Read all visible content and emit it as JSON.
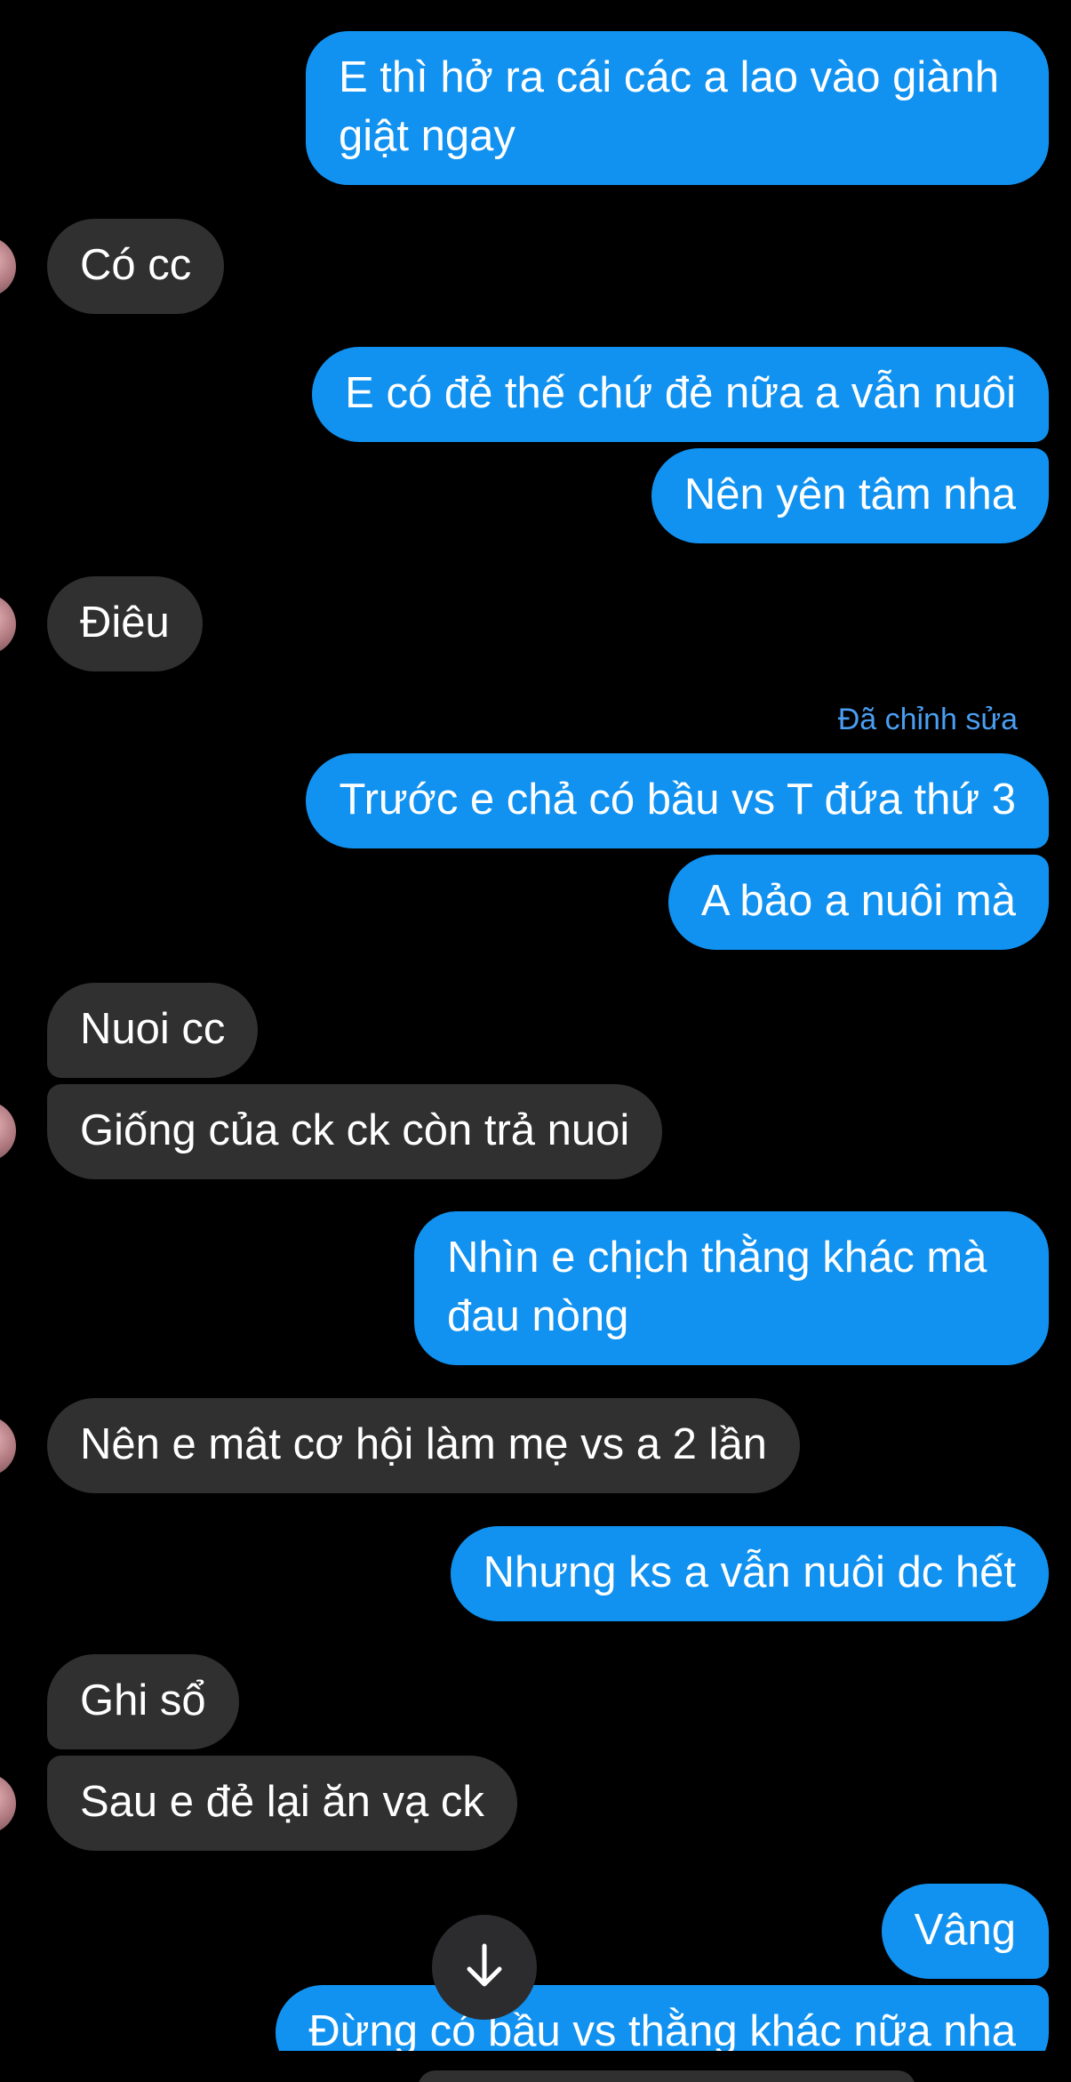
{
  "conversation": {
    "messages": [
      {
        "side": "out",
        "text": "E thì hở ra cái các a lao vào giành giật ngay"
      },
      {
        "side": "in",
        "text": "Có cc"
      },
      {
        "side": "out",
        "text": "E có đẻ thế chứ đẻ nữa a vẫn nuôi"
      },
      {
        "side": "out",
        "text": "Nên yên tâm nha"
      },
      {
        "side": "in",
        "text": "Điêu"
      },
      {
        "side": "out",
        "text": "Trước e chả có bầu vs T đứa thứ 3",
        "edited_label": "Đã chỉnh sửa"
      },
      {
        "side": "out",
        "text": "A bảo a nuôi mà"
      },
      {
        "side": "in",
        "text": "Nuoi cc"
      },
      {
        "side": "in",
        "text": "Giống của ck ck còn trả nuoi"
      },
      {
        "side": "out",
        "text": "Nhìn e chịch thằng khác mà đau nòng"
      },
      {
        "side": "in",
        "text": "Nên e mât cơ hội làm mẹ vs a 2 lần"
      },
      {
        "side": "out",
        "text": "Nhưng ks a vẫn nuôi dc hết"
      },
      {
        "side": "in",
        "text": "Ghi sổ"
      },
      {
        "side": "in",
        "text": "Sau e đẻ lại ăn vạ ck"
      },
      {
        "side": "out",
        "text": "Vâng"
      },
      {
        "side": "out",
        "text": "Đừng có bầu vs thằng khác nữa nha"
      }
    ]
  },
  "icons": {
    "scroll_down": "arrow-down-icon",
    "avatar": "contact-avatar"
  },
  "colors": {
    "background": "#000000",
    "outgoing_bubble": "#1192f0",
    "incoming_bubble": "#303030",
    "edited_label": "#4a9ef2",
    "text": "#ffffff"
  }
}
